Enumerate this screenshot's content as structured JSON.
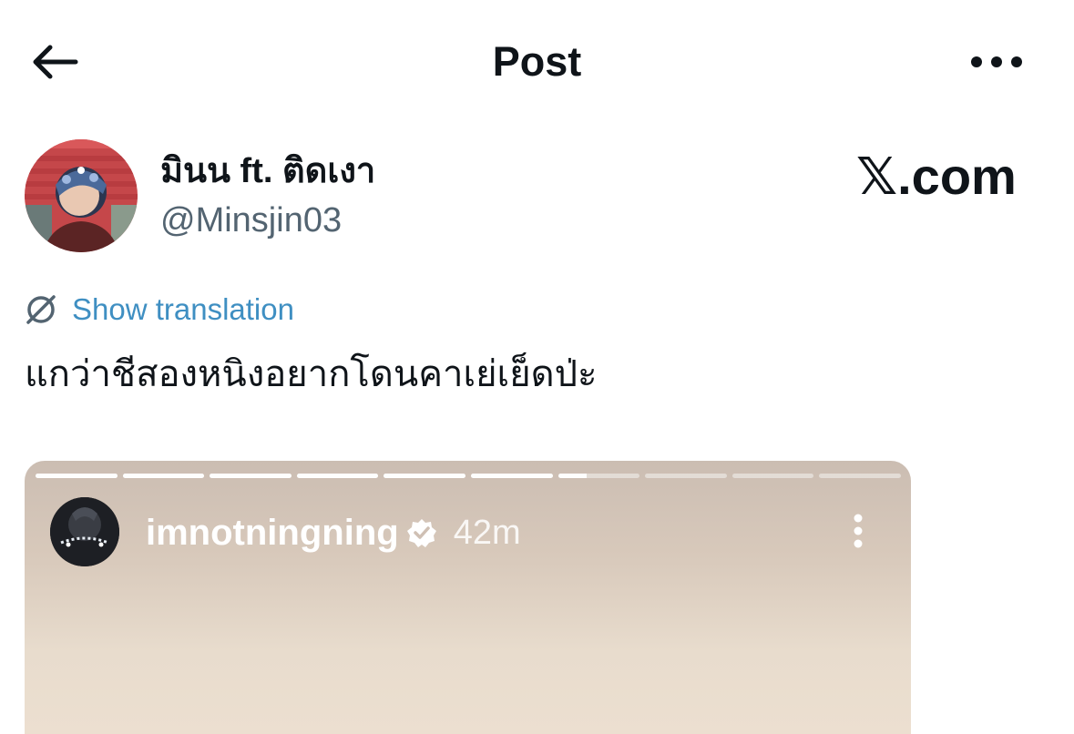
{
  "header": {
    "title": "Post",
    "back_icon": "arrow-left-icon",
    "more_icon": "more-horizontal-icon"
  },
  "author": {
    "display_name": "มินน ft. ติดเงา",
    "handle": "@Minsjin03"
  },
  "watermark": "𝕏.com",
  "translate": {
    "label": "Show translation",
    "icon": "translate-globe-icon"
  },
  "post": {
    "text": "แกว่าชีสองหนิงอยากโดนคาเย่เย็ดป่ะ"
  },
  "story": {
    "username": "imnotningning",
    "time": "42m",
    "verified": true,
    "segments_total": 10,
    "segments_completed": 6,
    "current_segment_progress": 0.35
  },
  "colors": {
    "link": "#3f8fc2",
    "secondary_text": "#536471",
    "primary_text": "#0f1419"
  }
}
